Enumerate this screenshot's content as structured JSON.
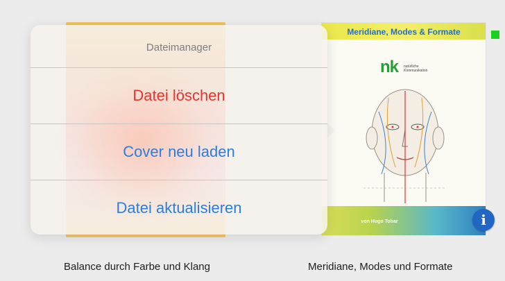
{
  "books": [
    {
      "caption": "Balance durch Farbe und Klang"
    },
    {
      "cover_title": "Meridiane, Modes & Formate",
      "cover_logo": "nk",
      "cover_logo_sub": "natürliche Kommunikation",
      "cover_author": "von Hugo Tobar",
      "caption": "Meridiane, Modes und Formate"
    }
  ],
  "popover": {
    "title": "Dateimanager",
    "items": [
      {
        "label": "Datei löschen",
        "style": "destructive"
      },
      {
        "label": "Cover neu laden",
        "style": "action"
      },
      {
        "label": "Datei aktualisieren",
        "style": "action"
      }
    ]
  },
  "info_button": {
    "icon": "info-icon",
    "glyph": "i"
  },
  "colors": {
    "destructive": "#e6352c",
    "action": "#2a7de1",
    "info": "#2266c4",
    "status_dot": "#19d11f"
  }
}
